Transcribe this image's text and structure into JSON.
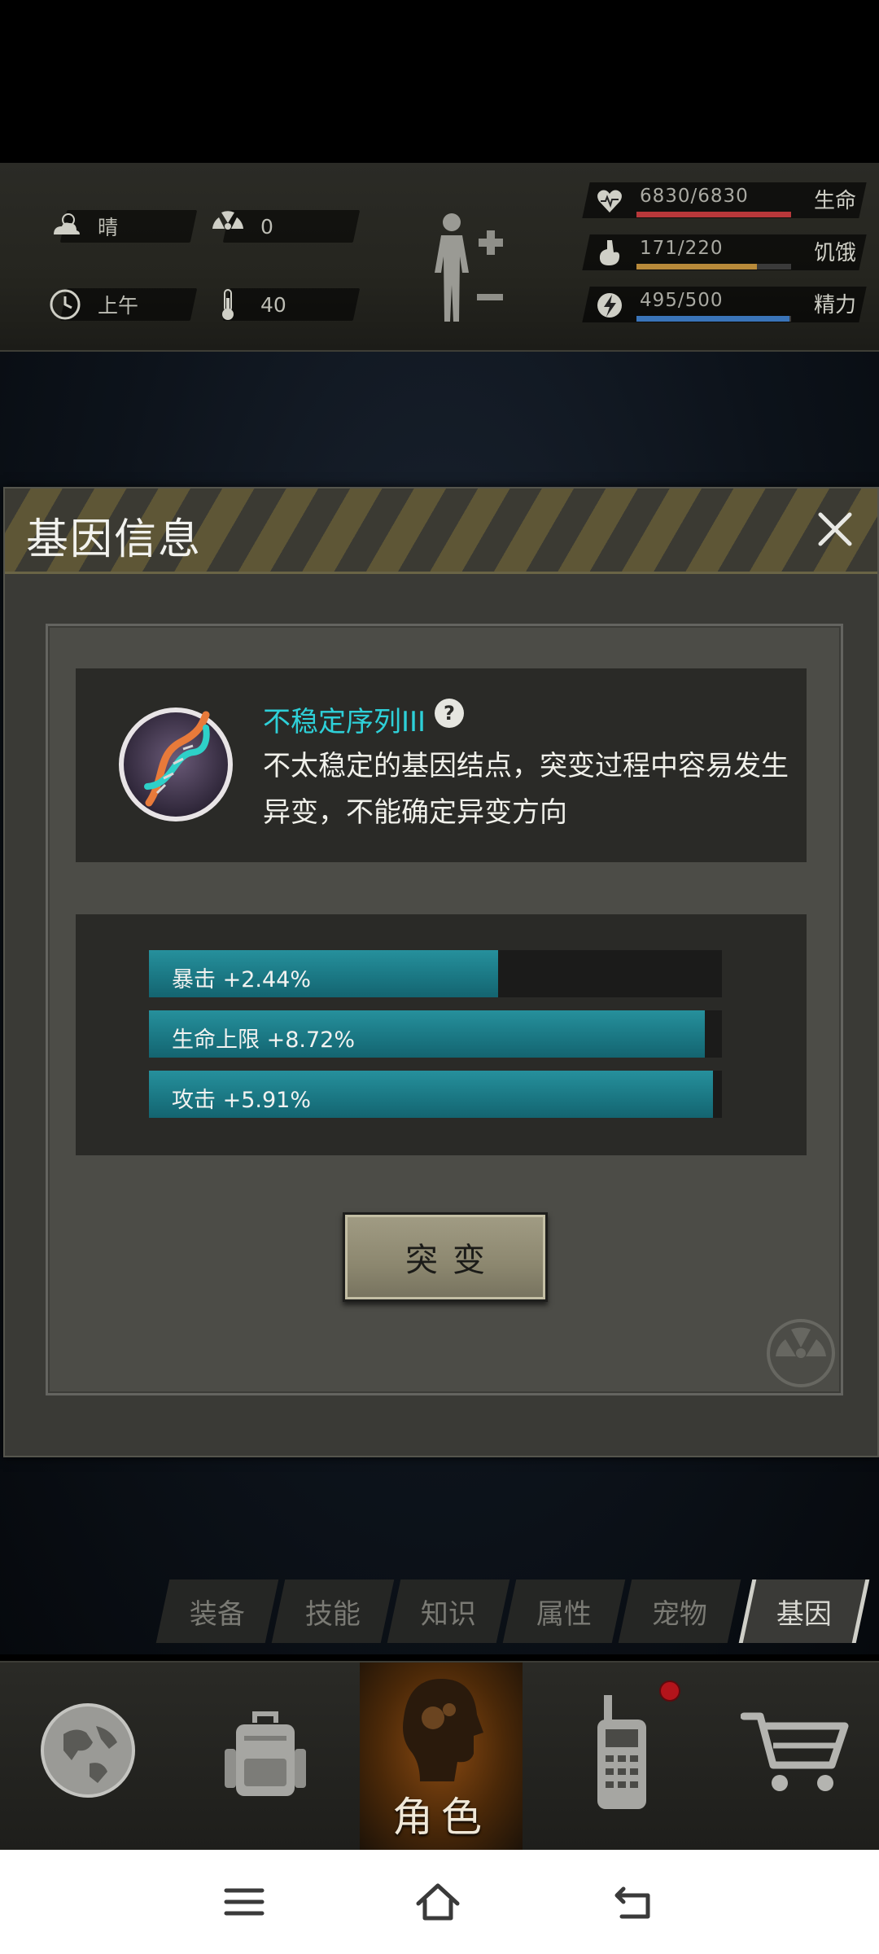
{
  "status": {
    "weather": {
      "icon": "weather-cloudy-sun-icon",
      "label": "晴"
    },
    "radiation": {
      "icon": "radiation-icon",
      "value": "0"
    },
    "time_of_day": {
      "icon": "clock-icon",
      "label": "上午"
    },
    "temperature": {
      "icon": "thermometer-icon",
      "value": "40"
    },
    "stats": [
      {
        "icon": "heart-pulse-icon",
        "value": "6830/6830",
        "label": "生命",
        "fraction": 1.0,
        "color": "#b8383a"
      },
      {
        "icon": "stomach-icon",
        "value": "171/220",
        "label": "饥饿",
        "fraction": 0.777,
        "color": "#b88a3a"
      },
      {
        "icon": "energy-bolt-icon",
        "value": "495/500",
        "label": "精力",
        "fraction": 0.99,
        "color": "#3a74b8"
      }
    ]
  },
  "dialog": {
    "title": "基因信息",
    "gene": {
      "icon": "dna-helix-icon",
      "name": "不稳定序列III",
      "description": "不太稳定的基因结点，突变过程中容易发生异变，不能确定异变方向"
    },
    "bonuses": [
      {
        "label": "暴击 +2.44%",
        "fraction": 0.61
      },
      {
        "label": "生命上限 +8.72%",
        "fraction": 0.97
      },
      {
        "label": "攻击 +5.91%",
        "fraction": 0.985
      }
    ],
    "mutate_label": "突变"
  },
  "tabs": [
    {
      "label": "装备",
      "active": false
    },
    {
      "label": "技能",
      "active": false
    },
    {
      "label": "知识",
      "active": false
    },
    {
      "label": "属性",
      "active": false
    },
    {
      "label": "宠物",
      "active": false
    },
    {
      "label": "基因",
      "active": true
    }
  ],
  "bottom_nav": {
    "items": [
      {
        "icon": "globe-icon"
      },
      {
        "icon": "backpack-icon"
      },
      {
        "icon": "character-head-icon",
        "label": "角色",
        "active": true
      },
      {
        "icon": "walkie-talkie-icon",
        "notification": true
      },
      {
        "icon": "shopping-cart-icon"
      }
    ]
  },
  "system_nav": {
    "icons": [
      "menu-icon",
      "home-icon",
      "back-icon"
    ]
  }
}
